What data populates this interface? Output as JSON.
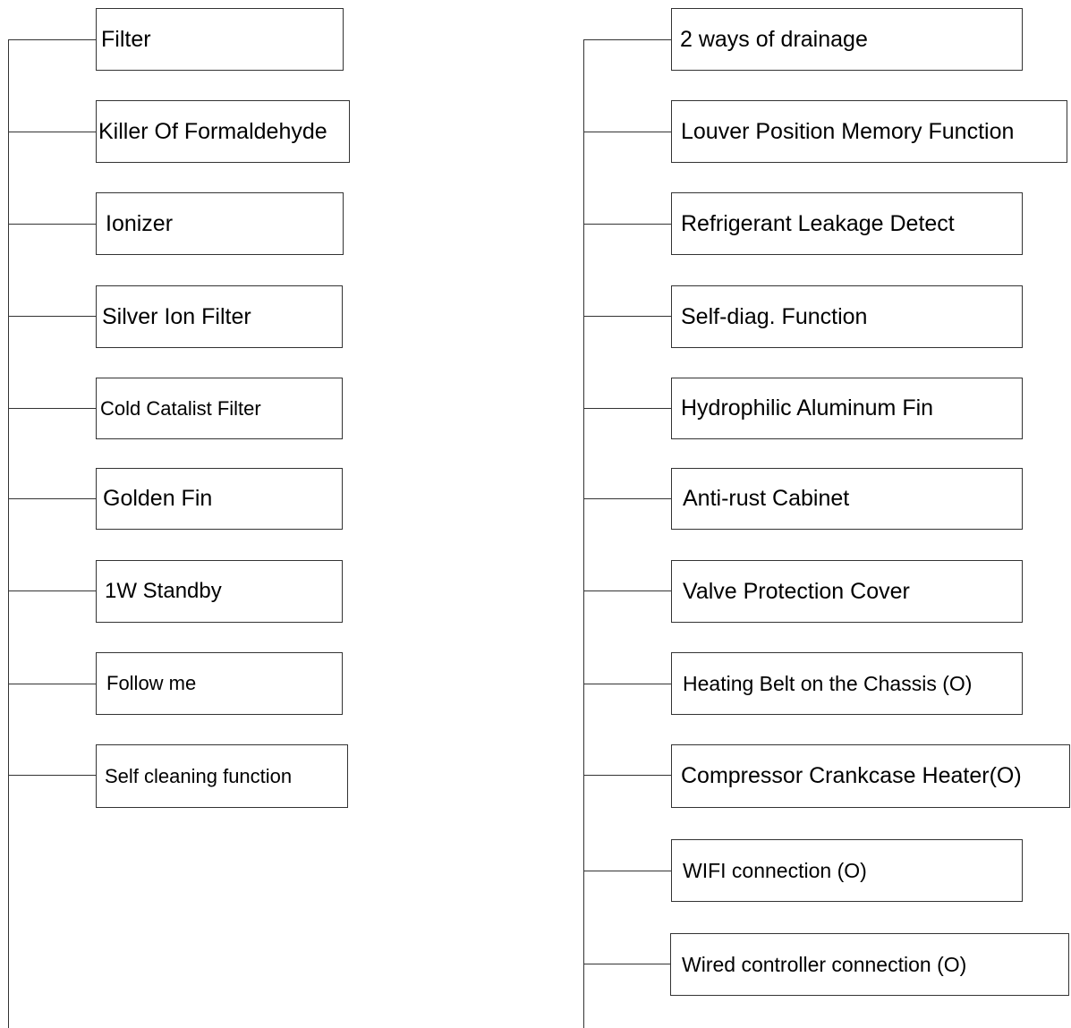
{
  "diagram": {
    "left_column": [
      "Filter",
      "Killer Of Formaldehyde",
      "Ionizer",
      "Silver Ion Filter",
      "Cold Catalist Filter",
      "Golden Fin",
      "1W Standby",
      "Follow me",
      "Self cleaning function"
    ],
    "right_column": [
      "2 ways of drainage",
      "Louver Position Memory Function",
      "Refrigerant Leakage Detect",
      "Self-diag. Function",
      "Hydrophilic Aluminum Fin",
      "Anti-rust Cabinet",
      "Valve Protection Cover",
      "Heating Belt on the Chassis (O)",
      "Compressor Crankcase Heater(O)",
      "WIFI connection (O)",
      "Wired controller connection (O)"
    ]
  }
}
